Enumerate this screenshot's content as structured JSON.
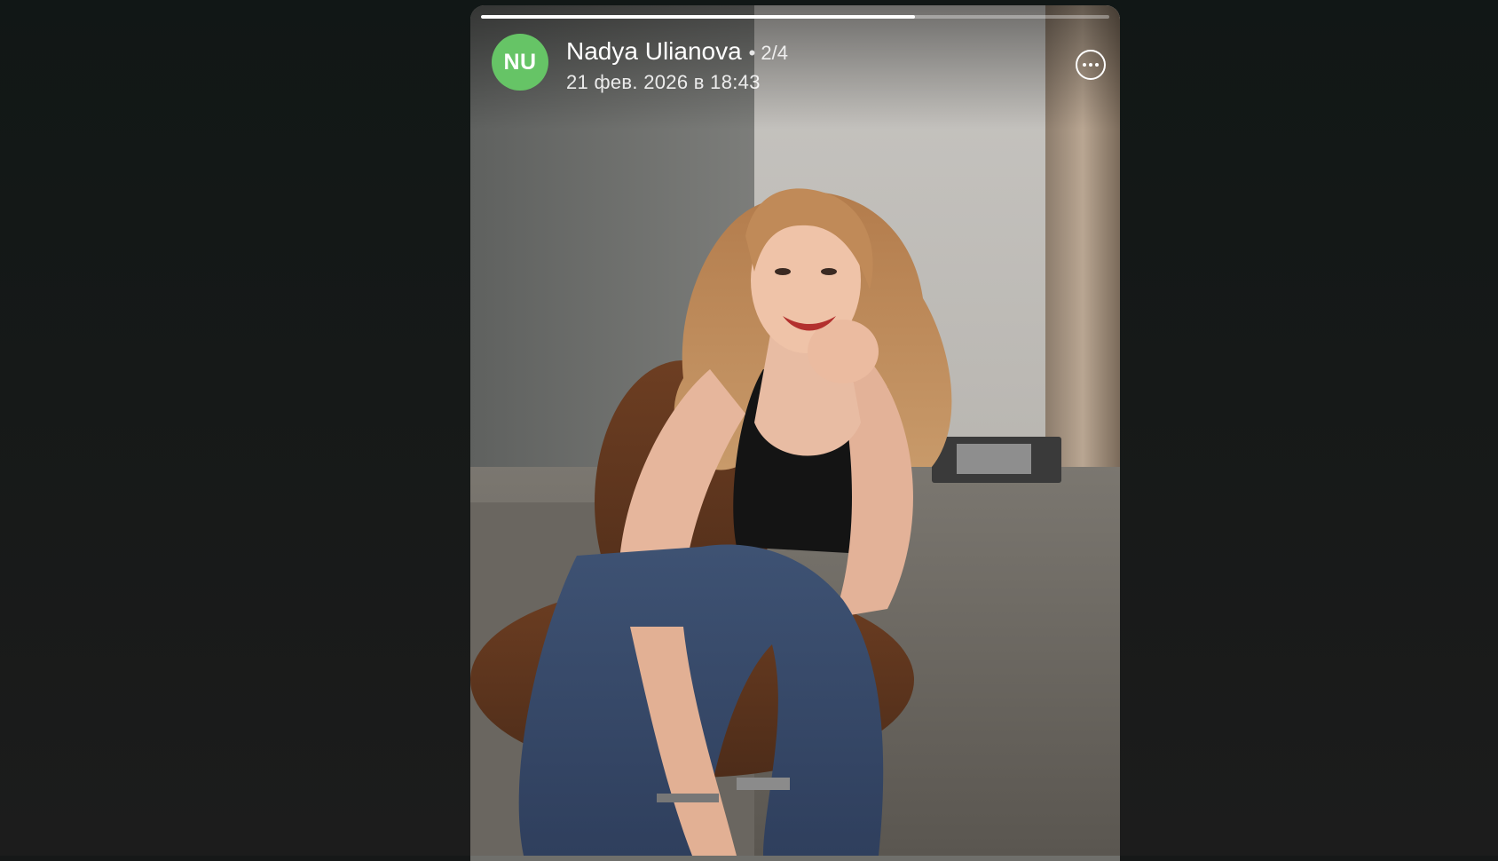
{
  "story": {
    "progress_segment_fraction": 0.69,
    "author": {
      "avatar_initials": "NU",
      "avatar_color": "#66c466",
      "name": "Nadya Ulianova",
      "separator": "•",
      "counter": "2/4",
      "date": "21 фев. 2026 в 18:43"
    },
    "menu_icon": "more-horizontal-icon",
    "photo_description_icon": "photo"
  }
}
